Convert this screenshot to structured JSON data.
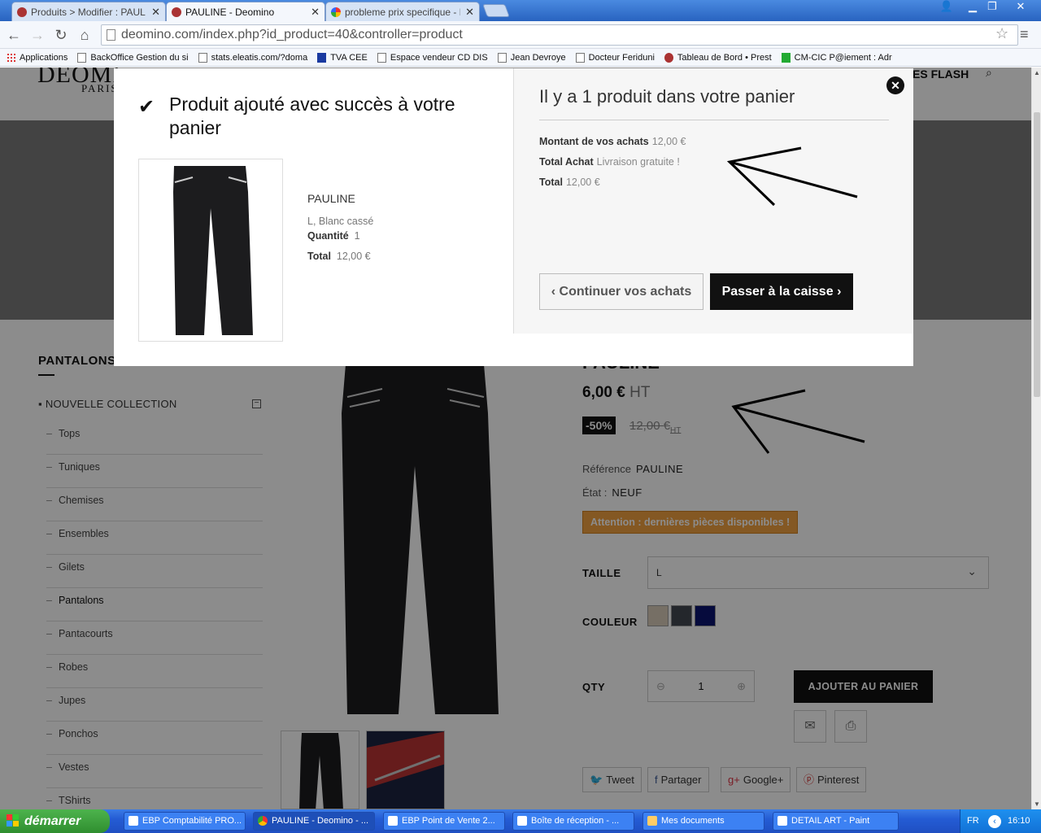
{
  "browser": {
    "tabs": [
      {
        "title": "Produits > Modifier : PAULINE",
        "active": false
      },
      {
        "title": "PAULINE - Deomino",
        "active": true
      },
      {
        "title": "probleme prix specifique - Re",
        "active": false
      }
    ],
    "url": "deomino.com/index.php?id_product=40&controller=product",
    "bookmarks": [
      "Applications",
      "BackOffice Gestion du si",
      "stats.eleatis.com/?doma",
      "TVA CEE",
      "Espace vendeur CD DIS",
      "Jean Devroye",
      "Docteur Feriduni",
      "Tableau de Bord • Prest",
      "CM-CIC P@iement : Adr"
    ]
  },
  "site": {
    "logo": "DEOMI",
    "logo_sub": "PARIS",
    "nav_flash": "ES FLASH"
  },
  "sidebar": {
    "title": "PANTALONS",
    "collection": "NOUVELLE COLLECTION",
    "collection_toggle": "−",
    "items": [
      "Tops",
      "Tuniques",
      "Chemises",
      "Ensembles",
      "Gilets",
      "Pantalons",
      "Pantacourts",
      "Robes",
      "Jupes",
      "Ponchos",
      "Vestes",
      "TShirts"
    ]
  },
  "product": {
    "name": "PAULINE",
    "price": "6,00 €",
    "price_suffix": "HT",
    "discount": "-50%",
    "old_price": "12,00 €",
    "old_price_suffix": "HT",
    "reference_label": "Référence",
    "reference": "PAULINE",
    "state_label": "État :",
    "state": "NEUF",
    "warning": "Attention : dernières pièces disponibles !",
    "size_label": "TAILLE",
    "size_value": "L",
    "color_label": "COULEUR",
    "colors": [
      "#d8cbb8",
      "#434750",
      "#0b1570"
    ],
    "qty_label": "QTY",
    "qty": "1",
    "add_to_cart": "AJOUTER AU PANIER",
    "share": [
      "Tweet",
      "Partager",
      "Google+",
      "Pinterest"
    ]
  },
  "modal": {
    "success_title": "Produit ajouté avec succès à votre panier",
    "product_name": "PAULINE",
    "attributes": "L, Blanc cassé",
    "qty_label": "Quantité",
    "qty": "1",
    "total_label": "Total",
    "total": "12,00 €",
    "cart_title": "Il y a 1 produit dans votre panier",
    "summary": [
      {
        "label": "Montant de vos achats",
        "value": "12,00 €"
      },
      {
        "label": "Total Achat",
        "value": "Livraison gratuite !"
      },
      {
        "label": "Total",
        "value": "12,00 €"
      }
    ],
    "continue": "Continuer vos achats",
    "checkout": "Passer à la caisse"
  },
  "taskbar": {
    "start": "démarrer",
    "tasks": [
      "EBP Comptabilité PRO...",
      "PAULINE - Deomino - ...",
      "EBP Point de Vente 2...",
      "Boîte de réception - ...",
      "Mes documents",
      "DETAIL ART - Paint"
    ],
    "lang": "FR",
    "clock": "16:10"
  },
  "colors": {
    "accent": "#111111",
    "warning": "#f0a040",
    "hero": "#7a7a7a"
  }
}
